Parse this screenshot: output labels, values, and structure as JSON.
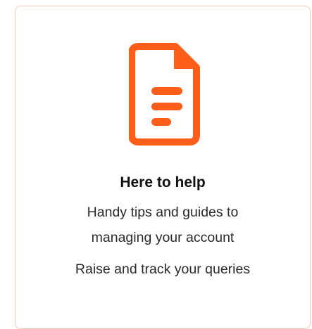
{
  "card": {
    "icon": "document-icon",
    "accent_color": "#ff5e1a",
    "title": "Here to help",
    "description_line1": "Handy tips and guides to",
    "description_line2": "managing your account",
    "secondary_line": "Raise and track your queries"
  }
}
